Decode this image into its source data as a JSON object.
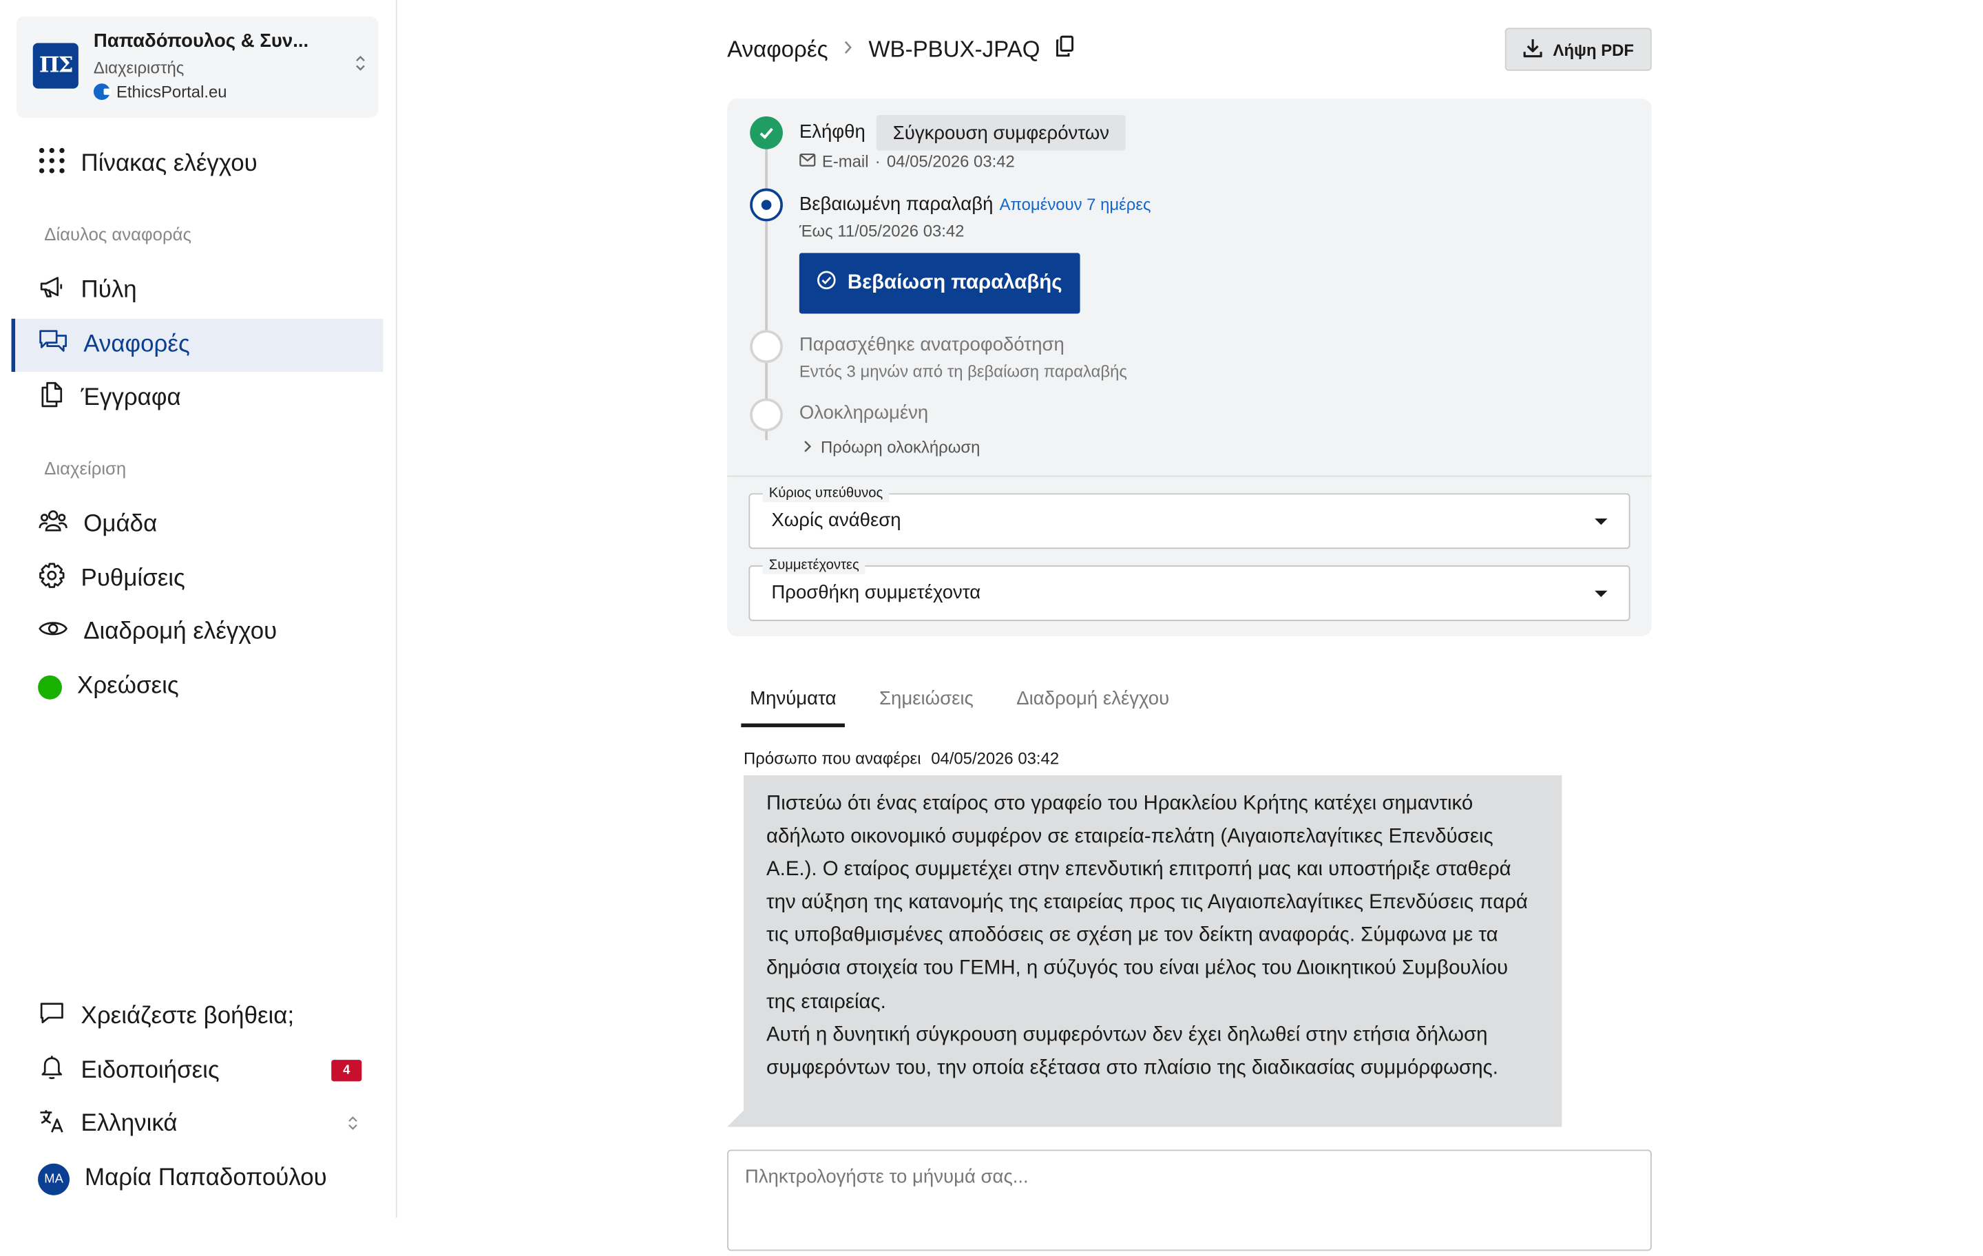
{
  "org": {
    "logo": "ΠΣ",
    "name": "Παπαδόπουλος & Συν...",
    "role": "Διαχειριστής",
    "site": "EthicsPortal.eu"
  },
  "nav": {
    "dashboard": "Πίνακας ελέγχου",
    "section_channel": "Δίαυλος αναφοράς",
    "portal": "Πύλη",
    "reports": "Αναφορές",
    "documents": "Έγγραφα",
    "section_admin": "Διαχείριση",
    "team": "Ομάδα",
    "settings": "Ρυθμίσεις",
    "audit": "Διαδρομή ελέγχου",
    "billing": "Χρεώσεις"
  },
  "footer": {
    "help": "Χρειάζεστε βοήθεια;",
    "notifications": "Ειδοποιήσεις",
    "notifications_count": "4",
    "language": "Ελληνικά",
    "user_initials": "ΜΑ",
    "user_name": "Μαρία Παπαδοπούλου"
  },
  "breadcrumb": {
    "parent": "Αναφορές",
    "case_id": "WB-PBUX-JPAQ"
  },
  "pdf_button": "Λήψη PDF",
  "timeline": {
    "received": {
      "title": "Ελήφθη",
      "category": "Σύγκρουση συμφερόντων",
      "channel": "E-mail",
      "sep": "·",
      "date": "04/05/2026 03:42"
    },
    "acknowledged": {
      "title": "Βεβαιωμένη παραλαβή",
      "remaining": "Απομένουν 7 ημέρες",
      "due": "Έως 11/05/2026 03:42",
      "button": "Βεβαίωση παραλαβής"
    },
    "feedback": {
      "title": "Παρασχέθηκε ανατροφοδότηση",
      "sub": "Εντός 3 μηνών από τη βεβαίωση παραλαβής"
    },
    "completed": {
      "title": "Ολοκληρωμένη",
      "early": "Πρόωρη ολοκλήρωση"
    }
  },
  "assignee": {
    "label": "Κύριος υπεύθυνος",
    "value": "Χωρίς ανάθεση"
  },
  "participants": {
    "label": "Συμμετέχοντες",
    "value": "Προσθήκη συμμετέχοντα"
  },
  "tabs": [
    "Μηνύματα",
    "Σημειώσεις",
    "Διαδρομή ελέγχου"
  ],
  "message": {
    "author": "Πρόσωπο που αναφέρει",
    "date": "04/05/2026 03:42",
    "paragraphs": [
      "Πιστεύω ότι ένας εταίρος στο γραφείο του Ηρακλείου Κρήτης κατέχει σημαντικό αδήλωτο οικονομικό συμφέρον σε εταιρεία-πελάτη (Αιγαιοπελαγίτικες Επενδύσεις Α.Ε.). Ο εταίρος συμμετέχει στην επενδυτική επιτροπή μας και υποστήριξε σταθερά την αύξηση της κατανομής της εταιρείας προς τις Αιγαιοπελαγίτικες Επενδύσεις παρά τις υποβαθμισμένες αποδόσεις σε σχέση με τον δείκτη αναφοράς. Σύμφωνα με τα δημόσια στοιχεία του ΓΕΜΗ, η σύζυγός του είναι μέλος του Διοικητικού Συμβουλίου της εταιρείας.",
      "Αυτή η δυνητική σύγκρουση συμφερόντων δεν έχει δηλωθεί στην ετήσια δήλωση συμφερόντων του, την οποία εξέτασα στο πλαίσιο της διαδικασίας συμμόρφωσης."
    ]
  },
  "composer": {
    "placeholder": "Πληκτρολογήστε το μήνυμά σας..."
  },
  "colors": {
    "brand": "#0b3f91",
    "success": "#1f9d62",
    "link": "#1466c8",
    "badge": "#c8102e",
    "billing_status": "#19b000"
  },
  "icons": {
    "dashboard": "grid-icon",
    "portal": "megaphone-icon",
    "reports": "chat-icon",
    "documents": "documents-icon",
    "team": "users-icon",
    "settings": "gear-icon",
    "audit": "eye-icon",
    "help": "chat-bubble-icon",
    "notifications": "bell-icon",
    "language": "translate-icon",
    "copy": "copy-icon",
    "download": "download-icon"
  }
}
